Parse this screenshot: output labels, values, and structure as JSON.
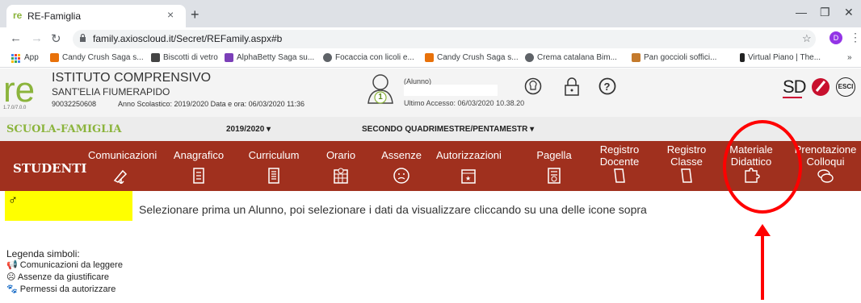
{
  "browser": {
    "tab_title": "RE-Famiglia",
    "tab_close": "×",
    "new_tab": "+",
    "url": "family.axioscloud.it/Secret/REFamily.aspx#b",
    "profile_initial": "D",
    "bookmarks": [
      {
        "label": "App"
      },
      {
        "label": "Candy Crush Saga s..."
      },
      {
        "label": "Biscotti di vetro"
      },
      {
        "label": "AlphaBetty Saga su..."
      },
      {
        "label": "Focaccia con licoli e..."
      },
      {
        "label": "Candy Crush Saga s..."
      },
      {
        "label": "Crema catalana Bim..."
      },
      {
        "label": "Pan goccioli soffici..."
      },
      {
        "label": "Virtual Piano | The..."
      }
    ],
    "more_bookmarks": "»"
  },
  "header": {
    "school_name": "ISTITUTO COMPRENSIVO",
    "school_sub": "SANT'ELIA FIUMERAPIDO",
    "school_code": "90032250608",
    "year_info": "Anno Scolastico: 2019/2020   Data e ora: 06/03/2020 11:36",
    "version": "1.7.0/7.0.0",
    "alunno_label": "(Alunno)",
    "last_access": "Ultimo Accesso: 06/03/2020 10.38.20",
    "student_count": "1",
    "brand_sd": "SD",
    "esci": "ESCI"
  },
  "school_row": {
    "label": "SCUOLA-FAMIGLIA",
    "year": "2019/2020  ▾",
    "period": "SECONDO QUADRIMESTRE/PENTAMESTR ▾"
  },
  "nav": {
    "section": "STUDENTI",
    "items": [
      {
        "l1": "Comunicazioni",
        "l2": ""
      },
      {
        "l1": "Anagrafico",
        "l2": ""
      },
      {
        "l1": "Curriculum",
        "l2": ""
      },
      {
        "l1": "Orario",
        "l2": ""
      },
      {
        "l1": "Assenze",
        "l2": ""
      },
      {
        "l1": "Autorizzazioni",
        "l2": ""
      },
      {
        "l1": "Pagella",
        "l2": ""
      },
      {
        "l1": "Registro",
        "l2": "Docente"
      },
      {
        "l1": "Registro",
        "l2": "Classe"
      },
      {
        "l1": "Materiale",
        "l2": "Didattico"
      },
      {
        "l1": "Prenotazione",
        "l2": "Colloqui"
      }
    ]
  },
  "content": {
    "male_symbol": "♂",
    "instruction": "Selezionare prima un Alunno, poi selezionare i dati da visualizzare cliccando su una delle icone sopra",
    "legenda_title": "Legenda simboli:",
    "legend": [
      "Comunicazioni da leggere",
      "Assenze da giustificare",
      "Permessi da autorizzare"
    ]
  },
  "colors": {
    "nav_bg": "#a0301e",
    "highlight_yellow": "#ffff00",
    "annotation_red": "#ff0000",
    "school_green": "#8bb43c"
  }
}
